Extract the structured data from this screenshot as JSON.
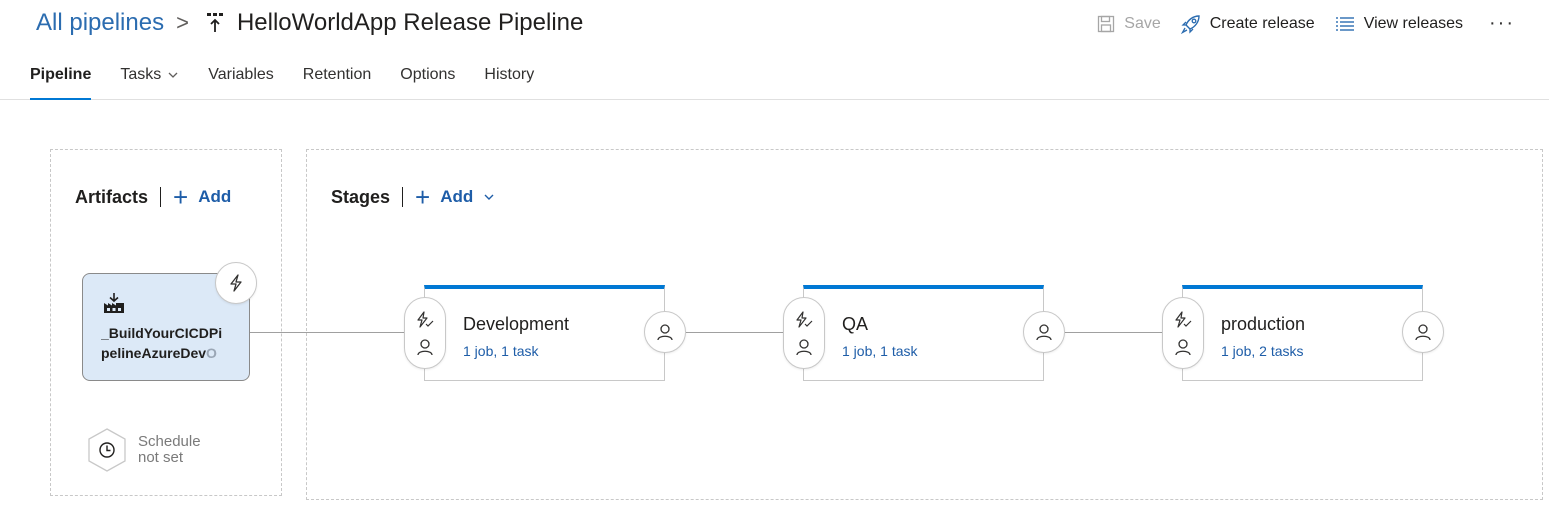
{
  "breadcrumb": {
    "root_label": "All pipelines",
    "separator": ">",
    "title": "HelloWorldApp Release Pipeline"
  },
  "toolbar": {
    "save_label": "Save",
    "create_release_label": "Create release",
    "view_releases_label": "View releases",
    "more_label": "···"
  },
  "tabs": [
    {
      "label": "Pipeline",
      "active": true
    },
    {
      "label": "Tasks",
      "active": false,
      "has_dropdown": true
    },
    {
      "label": "Variables",
      "active": false
    },
    {
      "label": "Retention",
      "active": false
    },
    {
      "label": "Options",
      "active": false
    },
    {
      "label": "History",
      "active": false
    }
  ],
  "artifacts": {
    "title": "Artifacts",
    "add_label": "Add",
    "card": {
      "line1": "_BuildYourCICDPi",
      "line2_visible": "pelineAzureDev",
      "line2_faded": "O",
      "icon": "build-artifact-icon"
    },
    "schedule": {
      "line1": "Schedule",
      "line2": "not set",
      "icon": "clock-icon"
    }
  },
  "stages": {
    "title": "Stages",
    "add_label": "Add",
    "items": [
      {
        "name": "Development",
        "summary": "1 job, 1 task"
      },
      {
        "name": "QA",
        "summary": "1 job, 1 task"
      },
      {
        "name": "production",
        "summary": "1 job, 2 tasks"
      }
    ]
  },
  "colors": {
    "accent": "#0078d4",
    "link": "#1e5da8",
    "artifact_bg": "#dce9f7"
  }
}
